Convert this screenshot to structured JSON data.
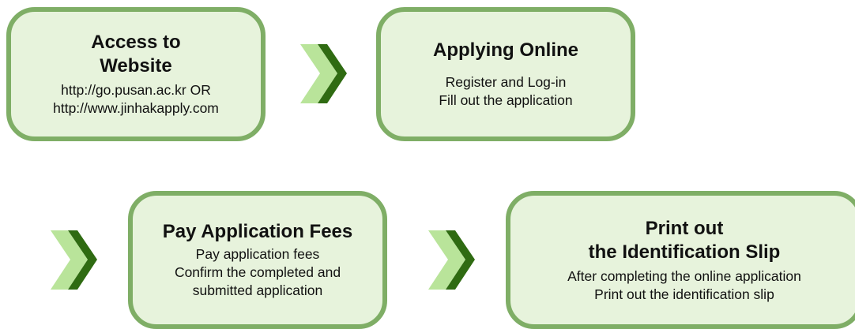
{
  "colors": {
    "box_fill": "#e7f3dc",
    "box_border": "#7fae66",
    "arrow_light": "#b9e49a",
    "arrow_dark": "#2f6b12"
  },
  "steps": [
    {
      "title": "Access to\nWebsite",
      "body": "http://go.pusan.ac.kr OR\nhttp://www.jinhakapply.com"
    },
    {
      "title": "Applying Online",
      "body": "Register and Log-in\nFill out the application"
    },
    {
      "title": "Pay Application Fees",
      "body": "Pay application fees\nConfirm the completed and\nsubmitted application"
    },
    {
      "title": "Print out\nthe Identification Slip",
      "body": "After completing the online application\nPrint out the identification slip"
    }
  ],
  "arrows": [
    {
      "icon": "double-chevron-right-icon"
    },
    {
      "icon": "double-chevron-right-icon"
    },
    {
      "icon": "double-chevron-right-icon"
    }
  ]
}
